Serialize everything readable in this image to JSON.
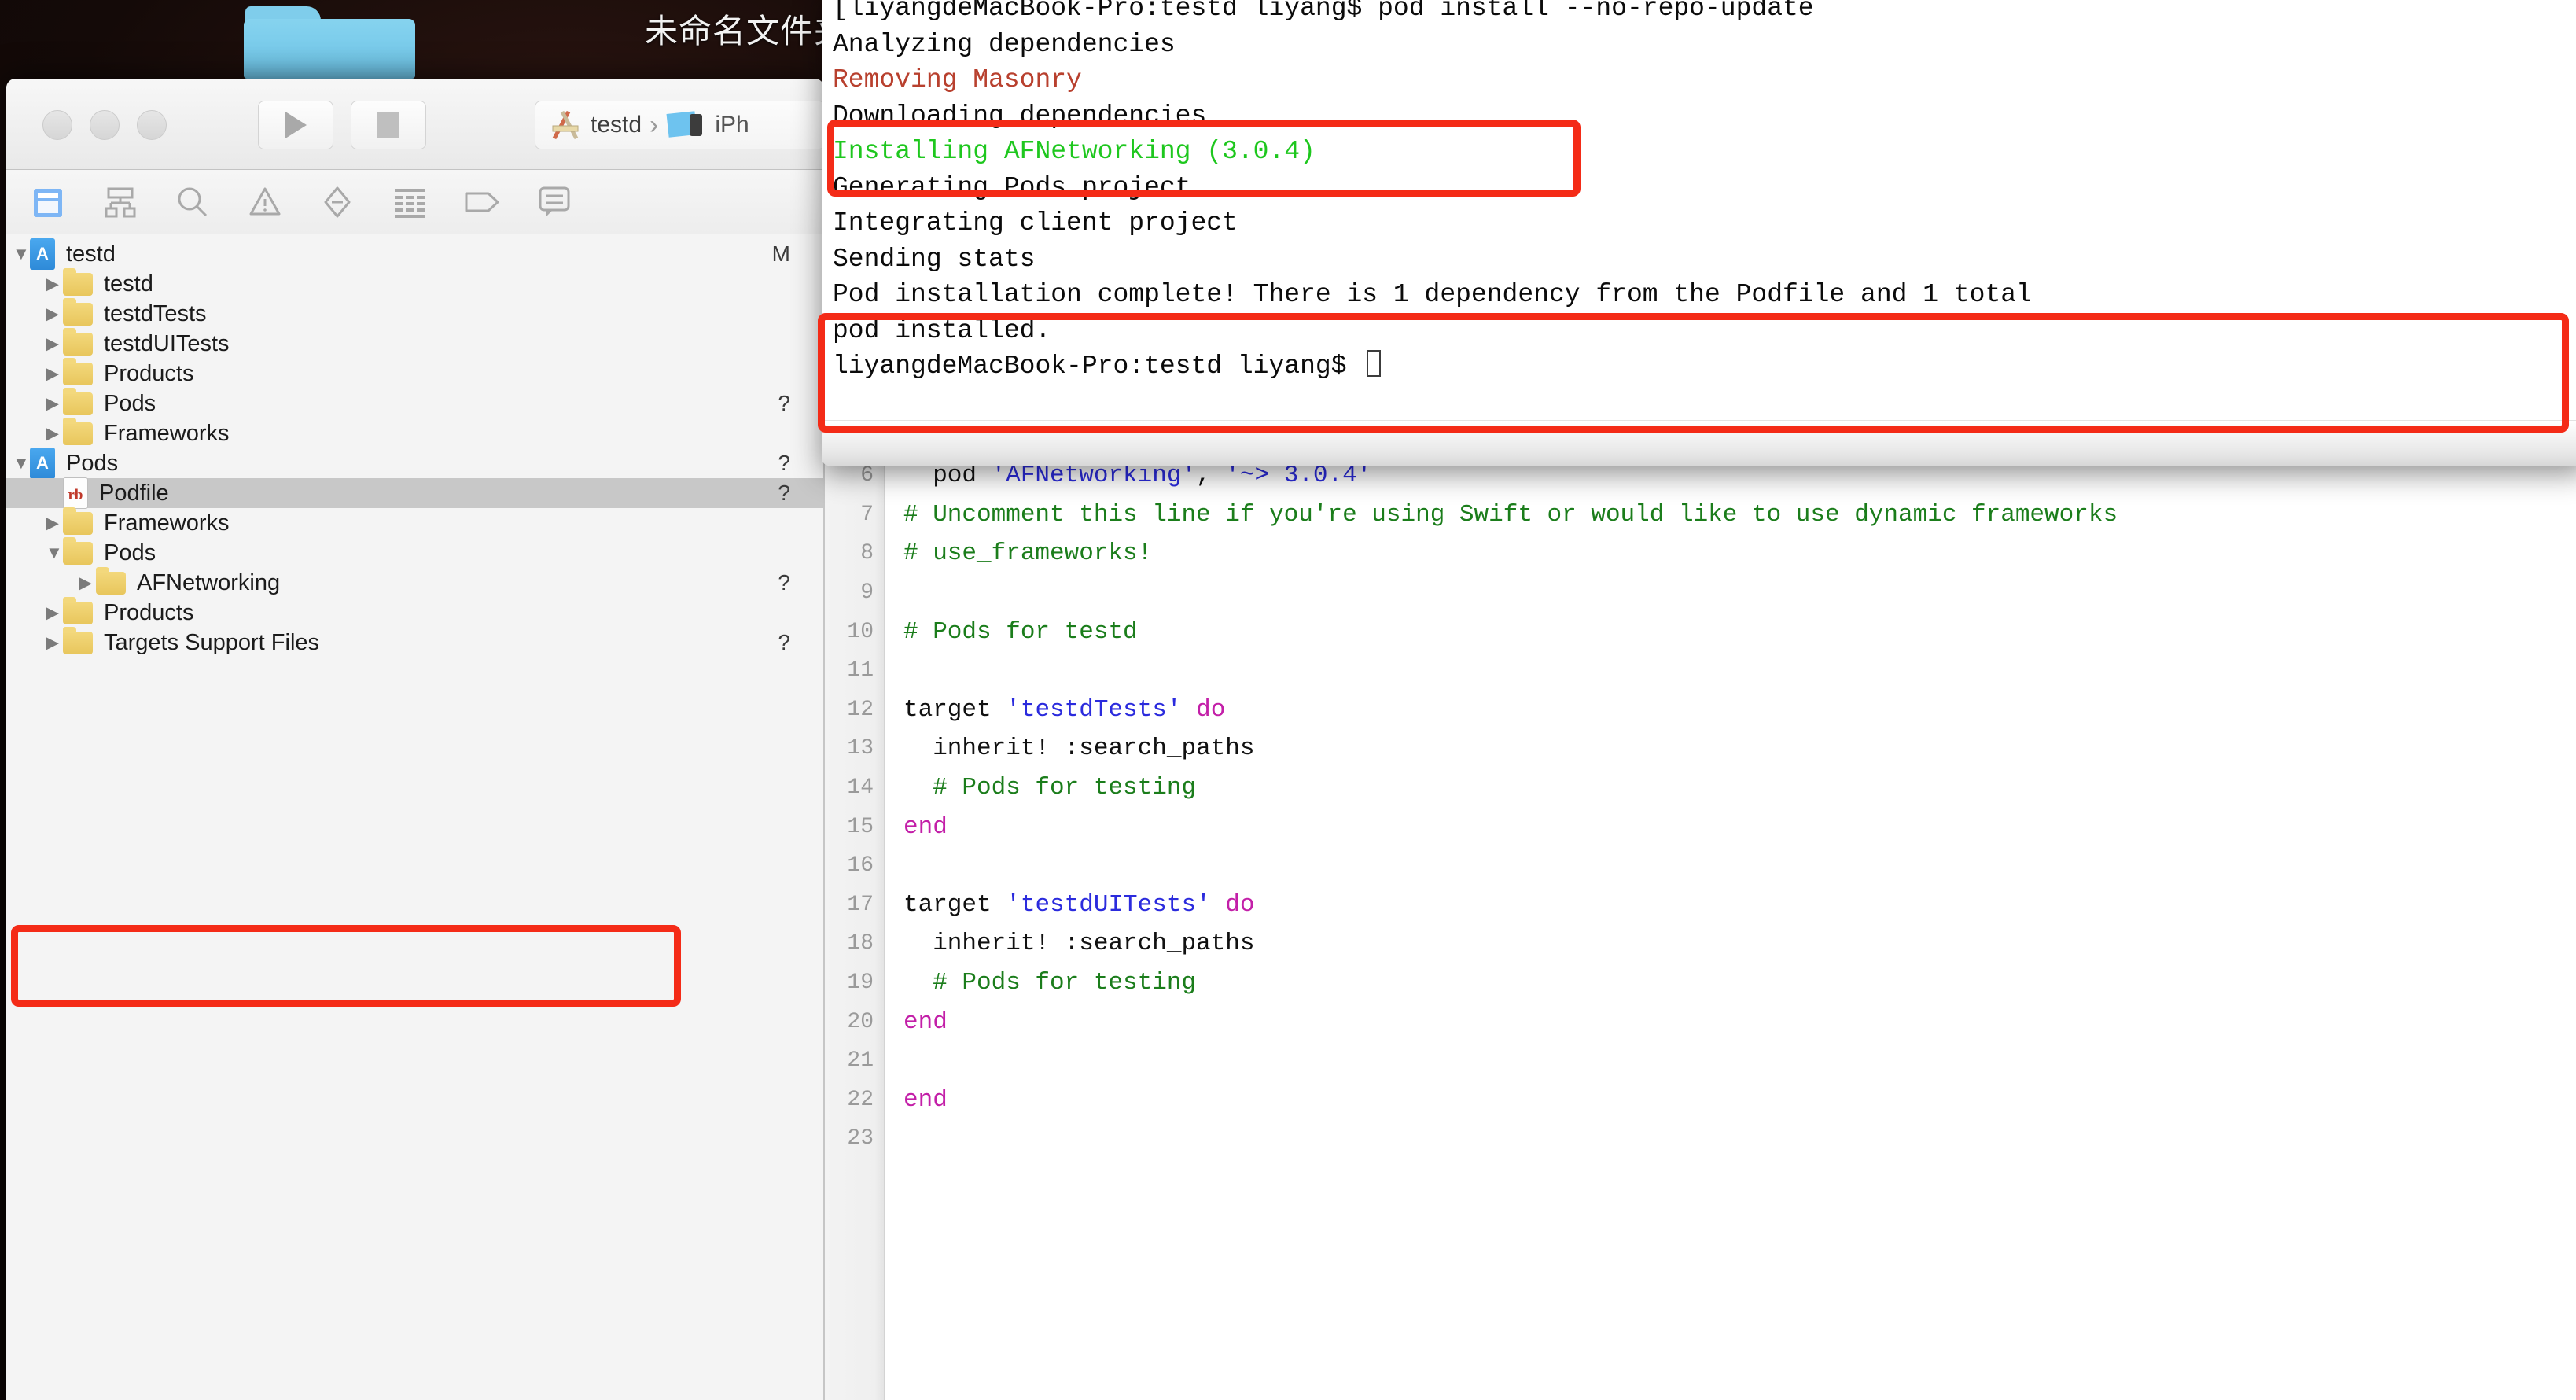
{
  "desktop": {
    "folder_icon": "blue-folder-icon",
    "caption": "未命名文件夹"
  },
  "xcode": {
    "titlebar": {
      "traffic_lights": [
        "close",
        "minimize",
        "zoom"
      ],
      "run_label": "Run",
      "stop_label": "Stop",
      "scheme_project": "testd",
      "scheme_separator": "›",
      "scheme_device": "iPh"
    },
    "navigator_tabs": [
      {
        "name": "project-navigator",
        "icon": "folder-icon",
        "active": true
      },
      {
        "name": "source-control-navigator",
        "icon": "sitemap-icon",
        "active": false
      },
      {
        "name": "symbol-navigator",
        "icon": "search-icon",
        "active": false
      },
      {
        "name": "issue-navigator",
        "icon": "warning-triangle-icon",
        "active": false
      },
      {
        "name": "test-navigator",
        "icon": "diamond-minus-icon",
        "active": false
      },
      {
        "name": "debug-navigator",
        "icon": "list-icon",
        "active": false
      },
      {
        "name": "breakpoint-navigator",
        "icon": "tag-icon",
        "active": false
      },
      {
        "name": "report-navigator",
        "icon": "speech-bubble-icon",
        "active": false
      }
    ],
    "tree": [
      {
        "label": "testd",
        "icon": "project-icon",
        "disclosure": "open",
        "indent": 0,
        "status": "M",
        "selected": false
      },
      {
        "label": "testd",
        "icon": "folder-icon",
        "disclosure": "closed",
        "indent": 1,
        "status": "",
        "selected": false
      },
      {
        "label": "testdTests",
        "icon": "folder-icon",
        "disclosure": "closed",
        "indent": 1,
        "status": "",
        "selected": false
      },
      {
        "label": "testdUITests",
        "icon": "folder-icon",
        "disclosure": "closed",
        "indent": 1,
        "status": "",
        "selected": false
      },
      {
        "label": "Products",
        "icon": "folder-icon",
        "disclosure": "closed",
        "indent": 1,
        "status": "",
        "selected": false
      },
      {
        "label": "Pods",
        "icon": "folder-icon",
        "disclosure": "closed",
        "indent": 1,
        "status": "?",
        "selected": false
      },
      {
        "label": "Frameworks",
        "icon": "folder-icon",
        "disclosure": "closed",
        "indent": 1,
        "status": "",
        "selected": false
      },
      {
        "label": "Pods",
        "icon": "project-icon",
        "disclosure": "open",
        "indent": 0,
        "status": "?",
        "selected": false
      },
      {
        "label": "Podfile",
        "icon": "ruby-file-icon",
        "disclosure": "none",
        "indent": 1,
        "status": "?",
        "selected": true
      },
      {
        "label": "Frameworks",
        "icon": "folder-icon",
        "disclosure": "closed",
        "indent": 1,
        "status": "",
        "selected": false
      },
      {
        "label": "Pods",
        "icon": "folder-icon",
        "disclosure": "open",
        "indent": 1,
        "status": "",
        "selected": false
      },
      {
        "label": "AFNetworking",
        "icon": "folder-icon",
        "disclosure": "closed",
        "indent": 2,
        "status": "?",
        "selected": false
      },
      {
        "label": "Products",
        "icon": "folder-icon",
        "disclosure": "closed",
        "indent": 1,
        "status": "",
        "selected": false
      },
      {
        "label": "Targets Support Files",
        "icon": "folder-icon",
        "disclosure": "closed",
        "indent": 1,
        "status": "?",
        "selected": false
      }
    ]
  },
  "editor": {
    "lines": [
      {
        "num": "6",
        "tokens": [
          {
            "t": "plain",
            "v": "  pod "
          },
          {
            "t": "str",
            "v": "'AFNetworking'"
          },
          {
            "t": "plain",
            "v": ", "
          },
          {
            "t": "str",
            "v": "'~> 3.0.4'"
          }
        ]
      },
      {
        "num": "7",
        "tokens": [
          {
            "t": "com",
            "v": "# Uncomment this line if you're using Swift or would like to use dynamic frameworks"
          }
        ]
      },
      {
        "num": "8",
        "tokens": [
          {
            "t": "com",
            "v": "# use_frameworks!"
          }
        ]
      },
      {
        "num": "9",
        "tokens": [
          {
            "t": "plain",
            "v": ""
          }
        ]
      },
      {
        "num": "10",
        "tokens": [
          {
            "t": "com",
            "v": "# Pods for testd"
          }
        ]
      },
      {
        "num": "11",
        "tokens": [
          {
            "t": "plain",
            "v": ""
          }
        ]
      },
      {
        "num": "12",
        "tokens": [
          {
            "t": "plain",
            "v": "target "
          },
          {
            "t": "str",
            "v": "'testdTests'"
          },
          {
            "t": "plain",
            "v": " "
          },
          {
            "t": "kw",
            "v": "do"
          }
        ]
      },
      {
        "num": "13",
        "tokens": [
          {
            "t": "plain",
            "v": "  inherit! :search_paths"
          }
        ]
      },
      {
        "num": "14",
        "tokens": [
          {
            "t": "com",
            "v": "  # Pods for testing"
          }
        ]
      },
      {
        "num": "15",
        "tokens": [
          {
            "t": "kw",
            "v": "end"
          }
        ]
      },
      {
        "num": "16",
        "tokens": [
          {
            "t": "plain",
            "v": ""
          }
        ]
      },
      {
        "num": "17",
        "tokens": [
          {
            "t": "plain",
            "v": "target "
          },
          {
            "t": "str",
            "v": "'testdUITests'"
          },
          {
            "t": "plain",
            "v": " "
          },
          {
            "t": "kw",
            "v": "do"
          }
        ]
      },
      {
        "num": "18",
        "tokens": [
          {
            "t": "plain",
            "v": "  inherit! :search_paths"
          }
        ]
      },
      {
        "num": "19",
        "tokens": [
          {
            "t": "com",
            "v": "  # Pods for testing"
          }
        ]
      },
      {
        "num": "20",
        "tokens": [
          {
            "t": "kw",
            "v": "end"
          }
        ]
      },
      {
        "num": "21",
        "tokens": [
          {
            "t": "plain",
            "v": ""
          }
        ]
      },
      {
        "num": "22",
        "tokens": [
          {
            "t": "kw",
            "v": "end"
          }
        ]
      },
      {
        "num": "23",
        "tokens": [
          {
            "t": "plain",
            "v": ""
          }
        ]
      }
    ]
  },
  "terminal": {
    "lines": [
      {
        "color": "default",
        "text": "[liyangdeMacBook-Pro:testd liyang$ pod install --no-repo-update"
      },
      {
        "color": "default",
        "text": "Analyzing dependencies"
      },
      {
        "color": "red",
        "text": "Removing Masonry"
      },
      {
        "color": "default",
        "text": "Downloading dependencies"
      },
      {
        "color": "green",
        "text": "Installing AFNetworking (3.0.4)"
      },
      {
        "color": "default",
        "text": "Generating Pods project"
      },
      {
        "color": "default",
        "text": "Integrating client project"
      },
      {
        "color": "default",
        "text": "Sending stats"
      },
      {
        "color": "default",
        "text": "Pod installation complete! There is 1 dependency from the Podfile and 1 total"
      },
      {
        "color": "default",
        "text": "pod installed."
      },
      {
        "color": "default",
        "text": "liyangdeMacBook-Pro:testd liyang$ ",
        "cursor": true
      }
    ]
  },
  "annotations": {
    "highlight_color": "#f42b17",
    "boxes": [
      {
        "name": "highlight-downloading-installing",
        "target": "terminal-install-lines"
      },
      {
        "name": "highlight-install-complete",
        "target": "terminal-complete-lines"
      },
      {
        "name": "highlight-afnetworking-row",
        "target": "tree-row-afnetworking"
      }
    ]
  }
}
